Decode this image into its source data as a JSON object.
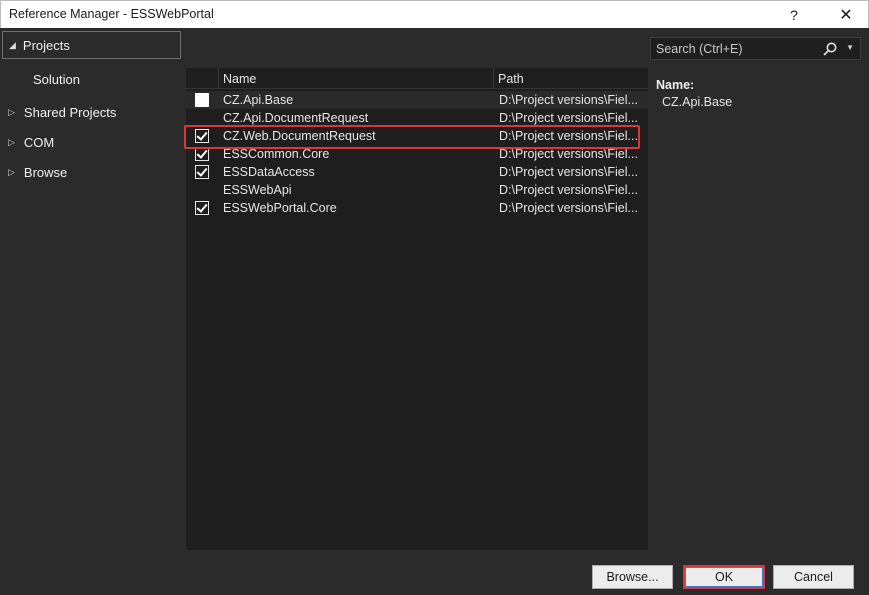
{
  "window": {
    "title": "Reference Manager - ESSWebPortal",
    "help_glyph": "?",
    "close_glyph": "✕"
  },
  "nav": {
    "projects_label": "Projects",
    "solution_label": "Solution",
    "shared_projects_label": "Shared Projects",
    "com_label": "COM",
    "browse_label": "Browse"
  },
  "search": {
    "placeholder": "Search (Ctrl+E)",
    "icon": "search-icon"
  },
  "list": {
    "columns": {
      "name": "Name",
      "path": "Path"
    },
    "rows": [
      {
        "name": "CZ.Api.Base",
        "path": "D:\\Project versions\\Fiel...",
        "checkbox": "unchecked"
      },
      {
        "name": "CZ.Api.DocumentRequest",
        "path": "D:\\Project versions\\Fiel...",
        "checkbox": "none"
      },
      {
        "name": "CZ.Web.DocumentRequest",
        "path": "D:\\Project versions\\Fiel...",
        "checkbox": "checked"
      },
      {
        "name": "ESSCommon.Core",
        "path": "D:\\Project versions\\Fiel...",
        "checkbox": "checked"
      },
      {
        "name": "ESSDataAccess",
        "path": "D:\\Project versions\\Fiel...",
        "checkbox": "checked"
      },
      {
        "name": "ESSWebApi",
        "path": "D:\\Project versions\\Fiel...",
        "checkbox": "none"
      },
      {
        "name": "ESSWebPortal.Core",
        "path": "D:\\Project versions\\Fiel...",
        "checkbox": "checked"
      }
    ]
  },
  "details": {
    "name_label": "Name:",
    "name_value": "CZ.Api.Base"
  },
  "footer": {
    "browse_button": "Browse...",
    "ok_button": "OK",
    "cancel_button": "Cancel"
  },
  "colors": {
    "highlight": "#d9373b",
    "background": "#2b2b2b",
    "list_background": "#1e1e1e"
  }
}
